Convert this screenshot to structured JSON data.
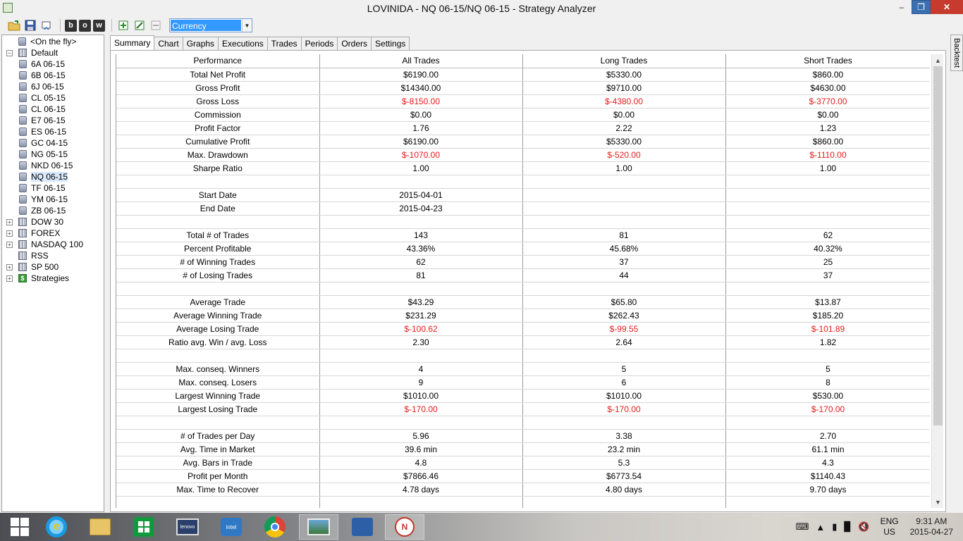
{
  "window": {
    "title": "LOVINIDA - NQ 06-15/NQ 06-15 - Strategy Analyzer",
    "controls": {
      "minimize": "–",
      "maximize": "❐",
      "close": "✕"
    }
  },
  "toolbar": {
    "buttons": [
      "open-folder-icon",
      "save-icon",
      "restore-icon",
      "b",
      "o",
      "w",
      "add-icon",
      "edit-icon",
      "remove-icon"
    ],
    "letters": {
      "b": "b",
      "o": "o",
      "w": "w"
    },
    "display_unit": {
      "selected": "Currency"
    }
  },
  "tree": {
    "items": [
      {
        "label": "<On the fly>",
        "icon": "database-icon"
      },
      {
        "label": "Default",
        "icon": "grid-icon",
        "expander": "−"
      },
      {
        "label": "6A 06-15",
        "icon": "database-icon"
      },
      {
        "label": "6B 06-15",
        "icon": "database-icon"
      },
      {
        "label": "6J 06-15",
        "icon": "database-icon"
      },
      {
        "label": "CL 05-15",
        "icon": "database-icon"
      },
      {
        "label": "CL 06-15",
        "icon": "database-icon"
      },
      {
        "label": "E7 06-15",
        "icon": "database-icon"
      },
      {
        "label": "ES 06-15",
        "icon": "database-icon"
      },
      {
        "label": "GC 04-15",
        "icon": "database-icon"
      },
      {
        "label": "NG 05-15",
        "icon": "database-icon"
      },
      {
        "label": "NKD 06-15",
        "icon": "database-icon"
      },
      {
        "label": "NQ 06-15",
        "icon": "database-icon",
        "selected": true
      },
      {
        "label": "TF 06-15",
        "icon": "database-icon"
      },
      {
        "label": "YM 06-15",
        "icon": "database-icon"
      },
      {
        "label": "ZB 06-15",
        "icon": "database-icon"
      },
      {
        "label": "DOW 30",
        "icon": "grid-icon",
        "expander": "+"
      },
      {
        "label": "FOREX",
        "icon": "grid-icon",
        "expander": "+"
      },
      {
        "label": "NASDAQ 100",
        "icon": "grid-icon",
        "expander": "+"
      },
      {
        "label": "RSS",
        "icon": "grid-icon"
      },
      {
        "label": "SP 500",
        "icon": "grid-icon",
        "expander": "+"
      },
      {
        "label": "Strategies",
        "icon": "dollar-icon",
        "expander": "+"
      }
    ]
  },
  "tabs": [
    "Summary",
    "Chart",
    "Graphs",
    "Executions",
    "Trades",
    "Periods",
    "Orders",
    "Settings"
  ],
  "active_tab": "Summary",
  "side_tab": "Backtest",
  "summary": {
    "columns": [
      "Performance",
      "All Trades",
      "Long Trades",
      "Short Trades"
    ],
    "rows": [
      {
        "label": "Total Net Profit",
        "all": "$6190.00",
        "long": "$5330.00",
        "short": "$860.00"
      },
      {
        "label": "Gross Profit",
        "all": "$14340.00",
        "long": "$9710.00",
        "short": "$4630.00"
      },
      {
        "label": "Gross Loss",
        "all": "$-8150.00",
        "long": "$-4380.00",
        "short": "$-3770.00",
        "negative": true
      },
      {
        "label": "Commission",
        "all": "$0.00",
        "long": "$0.00",
        "short": "$0.00"
      },
      {
        "label": "Profit Factor",
        "all": "1.76",
        "long": "2.22",
        "short": "1.23"
      },
      {
        "label": "Cumulative Profit",
        "all": "$6190.00",
        "long": "$5330.00",
        "short": "$860.00"
      },
      {
        "label": "Max. Drawdown",
        "all": "$-1070.00",
        "long": "$-520.00",
        "short": "$-1110.00",
        "negative": true
      },
      {
        "label": "Sharpe Ratio",
        "all": "1.00",
        "long": "1.00",
        "short": "1.00"
      },
      {
        "blank": true
      },
      {
        "label": "Start Date",
        "all": "2015-04-01",
        "long": "",
        "short": ""
      },
      {
        "label": "End Date",
        "all": "2015-04-23",
        "long": "",
        "short": ""
      },
      {
        "blank": true
      },
      {
        "label": "Total # of Trades",
        "all": "143",
        "long": "81",
        "short": "62"
      },
      {
        "label": "Percent Profitable",
        "all": "43.36%",
        "long": "45.68%",
        "short": "40.32%"
      },
      {
        "label": "# of Winning Trades",
        "all": "62",
        "long": "37",
        "short": "25"
      },
      {
        "label": "# of Losing Trades",
        "all": "81",
        "long": "44",
        "short": "37"
      },
      {
        "blank": true
      },
      {
        "label": "Average Trade",
        "all": "$43.29",
        "long": "$65.80",
        "short": "$13.87"
      },
      {
        "label": "Average Winning Trade",
        "all": "$231.29",
        "long": "$262.43",
        "short": "$185.20"
      },
      {
        "label": "Average Losing Trade",
        "all": "$-100.62",
        "long": "$-99.55",
        "short": "$-101.89",
        "negative": true
      },
      {
        "label": "Ratio avg. Win / avg. Loss",
        "all": "2.30",
        "long": "2.64",
        "short": "1.82"
      },
      {
        "blank": true
      },
      {
        "label": "Max. conseq. Winners",
        "all": "4",
        "long": "5",
        "short": "5"
      },
      {
        "label": "Max. conseq. Losers",
        "all": "9",
        "long": "6",
        "short": "8"
      },
      {
        "label": "Largest Winning Trade",
        "all": "$1010.00",
        "long": "$1010.00",
        "short": "$530.00"
      },
      {
        "label": "Largest Losing Trade",
        "all": "$-170.00",
        "long": "$-170.00",
        "short": "$-170.00",
        "negative": true
      },
      {
        "blank": true
      },
      {
        "label": "# of Trades per Day",
        "all": "5.96",
        "long": "3.38",
        "short": "2.70"
      },
      {
        "label": "Avg. Time in Market",
        "all": "39.6 min",
        "long": "23.2 min",
        "short": "61.1 min"
      },
      {
        "label": "Avg. Bars in Trade",
        "all": "4.8",
        "long": "5.3",
        "short": "4.3"
      },
      {
        "label": "Profit per Month",
        "all": "$7866.46",
        "long": "$6773.54",
        "short": "$1140.43"
      },
      {
        "label": "Max. Time to Recover",
        "all": "4.78 days",
        "long": "4.80 days",
        "short": "9.70 days"
      },
      {
        "blank": true
      }
    ],
    "negative_color": "#e81b1b"
  },
  "taskbar": {
    "apps": [
      "start-icon",
      "internet-explorer-icon",
      "file-explorer-icon",
      "store-icon",
      "lenovo-icon",
      "intel-icon",
      "chrome-icon",
      "photos-icon",
      "network-icon",
      "ninjatrader-icon"
    ],
    "lenovo_text": "lenovo",
    "intel_text": "intel",
    "ie_text": "e",
    "nt_text": "N",
    "lang_top": "ENG",
    "lang_bottom": "US",
    "time": "9:31 AM",
    "date": "2015-04-27"
  }
}
